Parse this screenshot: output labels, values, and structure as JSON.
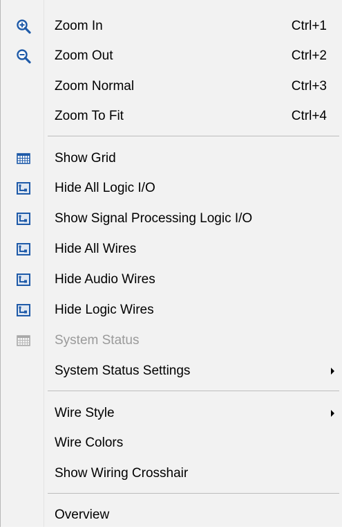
{
  "menu": {
    "items": [
      {
        "label": "Zoom In",
        "shortcut": "Ctrl+1",
        "icon": "zoom-in-icon"
      },
      {
        "label": "Zoom Out",
        "shortcut": "Ctrl+2",
        "icon": "zoom-out-icon"
      },
      {
        "label": "Zoom Normal",
        "shortcut": "Ctrl+3"
      },
      {
        "label": "Zoom To Fit",
        "shortcut": "Ctrl+4"
      },
      {
        "label": "Show Grid",
        "icon": "grid-icon"
      },
      {
        "label": "Hide All Logic I/O",
        "icon": "logic-io-icon"
      },
      {
        "label": "Show Signal Processing Logic I/O",
        "icon": "logic-io-icon"
      },
      {
        "label": "Hide All Wires",
        "icon": "wires-icon"
      },
      {
        "label": "Hide Audio Wires",
        "icon": "wires-icon"
      },
      {
        "label": "Hide Logic Wires",
        "icon": "wires-icon"
      },
      {
        "label": "System Status",
        "icon": "system-status-icon",
        "disabled": true
      },
      {
        "label": "System Status Settings",
        "submenu": true
      },
      {
        "label": "Wire Style",
        "submenu": true
      },
      {
        "label": "Wire Colors"
      },
      {
        "label": "Show Wiring Crosshair"
      },
      {
        "label": "Overview"
      }
    ]
  },
  "colors": {
    "menu_background": "#f2f2f2",
    "icon_blue": "#1e5aa8",
    "icon_fill": "#dfe7f2",
    "disabled_text": "#9a9a9a"
  }
}
